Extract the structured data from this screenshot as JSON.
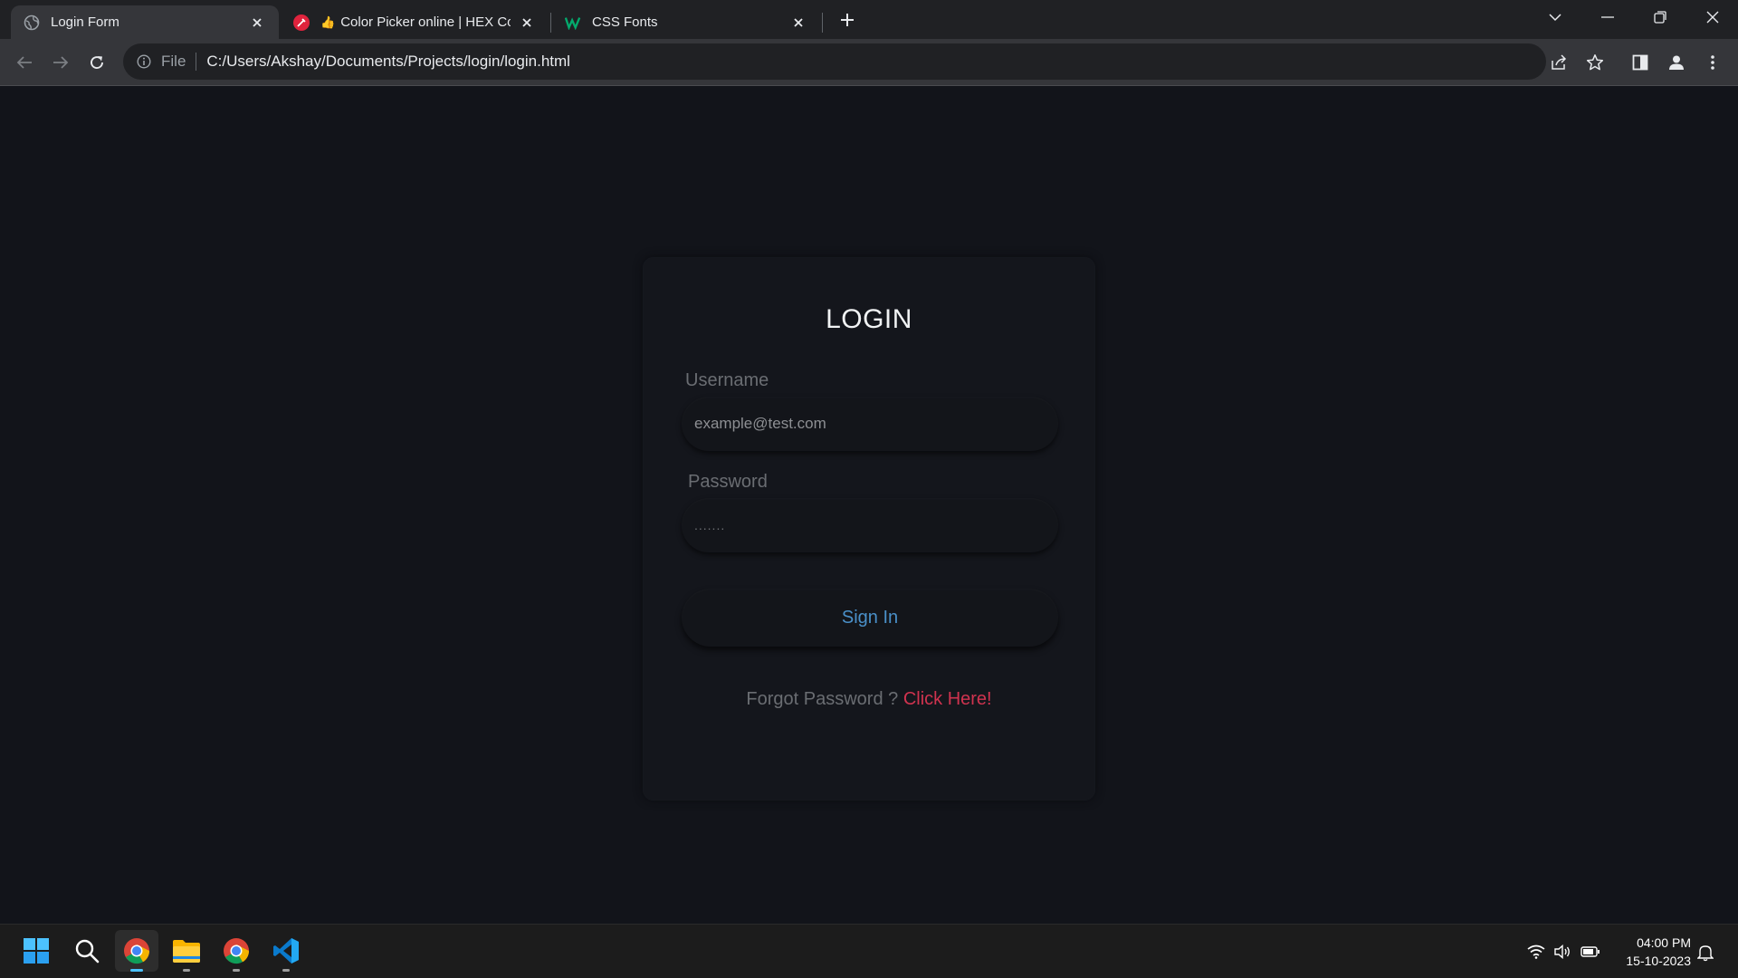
{
  "browser": {
    "tabs": [
      {
        "title": "Login Form",
        "icon": "globe-icon",
        "active": true
      },
      {
        "title": "Color Picker online | HEX Co",
        "icon": "color-picker-favicon",
        "prefix_emoji": "👍",
        "active": false
      },
      {
        "title": "CSS Fonts",
        "icon": "w3schools-favicon",
        "active": false
      }
    ],
    "address": {
      "scheme_label": "File",
      "url": "C:/Users/Akshay/Documents/Projects/login/login.html"
    }
  },
  "page": {
    "title": "LOGIN",
    "username_label": "Username",
    "username_placeholder": "example@test.com",
    "password_label": "Password",
    "password_value": ".......",
    "signin_label": "Sign In",
    "forgot_text": "Forgot Password ?",
    "forgot_link": "Click Here!"
  },
  "taskbar": {
    "apps": [
      "windows-start-icon",
      "search-icon",
      "chrome-icon",
      "file-explorer-icon",
      "chrome-icon",
      "vscode-icon"
    ],
    "time": "04:00 PM",
    "date": "15-10-2023"
  },
  "colors": {
    "page_bg": "#12141a",
    "signin_text": "#4a90c9",
    "link": "#d0334f",
    "label": "#6a6d72"
  }
}
